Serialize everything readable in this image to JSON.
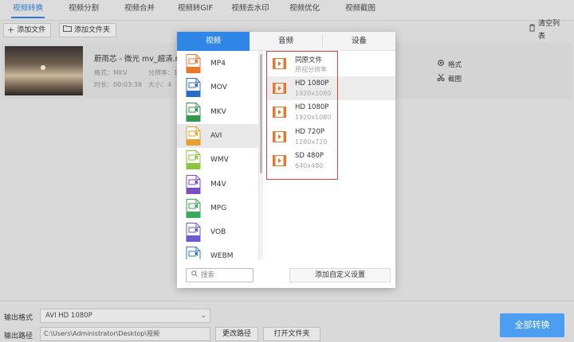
{
  "tabs": [
    "视频转换",
    "视频分割",
    "视频合并",
    "视频转GIF",
    "视频去水印",
    "视频优化",
    "视频截图"
  ],
  "toolbar": {
    "add_file": "添加文件",
    "add_folder": "添加文件夹",
    "clear_list": "清空列表"
  },
  "file": {
    "name": "蔚雨芯 - 微光 mv_超清.ml",
    "format_label": "格式：MKV",
    "resolution_label": "分辨率：1",
    "duration_label": "时长：00:03:38",
    "size_label": "大小：4",
    "format_action": "格式",
    "screenshot_action": "截图"
  },
  "popup": {
    "tabs": [
      "视频",
      "音频",
      "设备"
    ],
    "formats": [
      {
        "name": "MP4",
        "color": "#e8772e"
      },
      {
        "name": "MOV",
        "color": "#2b6cc4"
      },
      {
        "name": "MKV",
        "color": "#2e9a4a"
      },
      {
        "name": "AVI",
        "color": "#e8a02e"
      },
      {
        "name": "WMV",
        "color": "#8cc63f"
      },
      {
        "name": "M4V",
        "color": "#7a4fc4"
      },
      {
        "name": "MPG",
        "color": "#3aab5a"
      },
      {
        "name": "VOB",
        "color": "#6a5acd"
      },
      {
        "name": "WEBM",
        "color": "#3a7bd5"
      }
    ],
    "resolutions": [
      {
        "name": "同原文件",
        "sub": "原视分辨率"
      },
      {
        "name": "HD 1080P",
        "sub": "1920x1080"
      },
      {
        "name": "HD 1080P",
        "sub": "1920x1080"
      },
      {
        "name": "HD 720P",
        "sub": "1280x720"
      },
      {
        "name": "SD 480P",
        "sub": "640x480"
      }
    ],
    "search_placeholder": "搜索",
    "custom_settings": "添加自定义设置"
  },
  "bottom": {
    "output_format_label": "输出格式",
    "output_format_value": "AVI  HD 1080P",
    "output_path_label": "输出路径",
    "output_path_value": "C:\\Users\\Administrator\\Desktop\\视频",
    "change_path": "更改路径",
    "open_folder": "打开文件夹",
    "convert_all": "全部转换"
  },
  "colors": {
    "accent": "#2f86e6",
    "highlight_box": "#e0443a",
    "video_icon": "#e8772e"
  }
}
